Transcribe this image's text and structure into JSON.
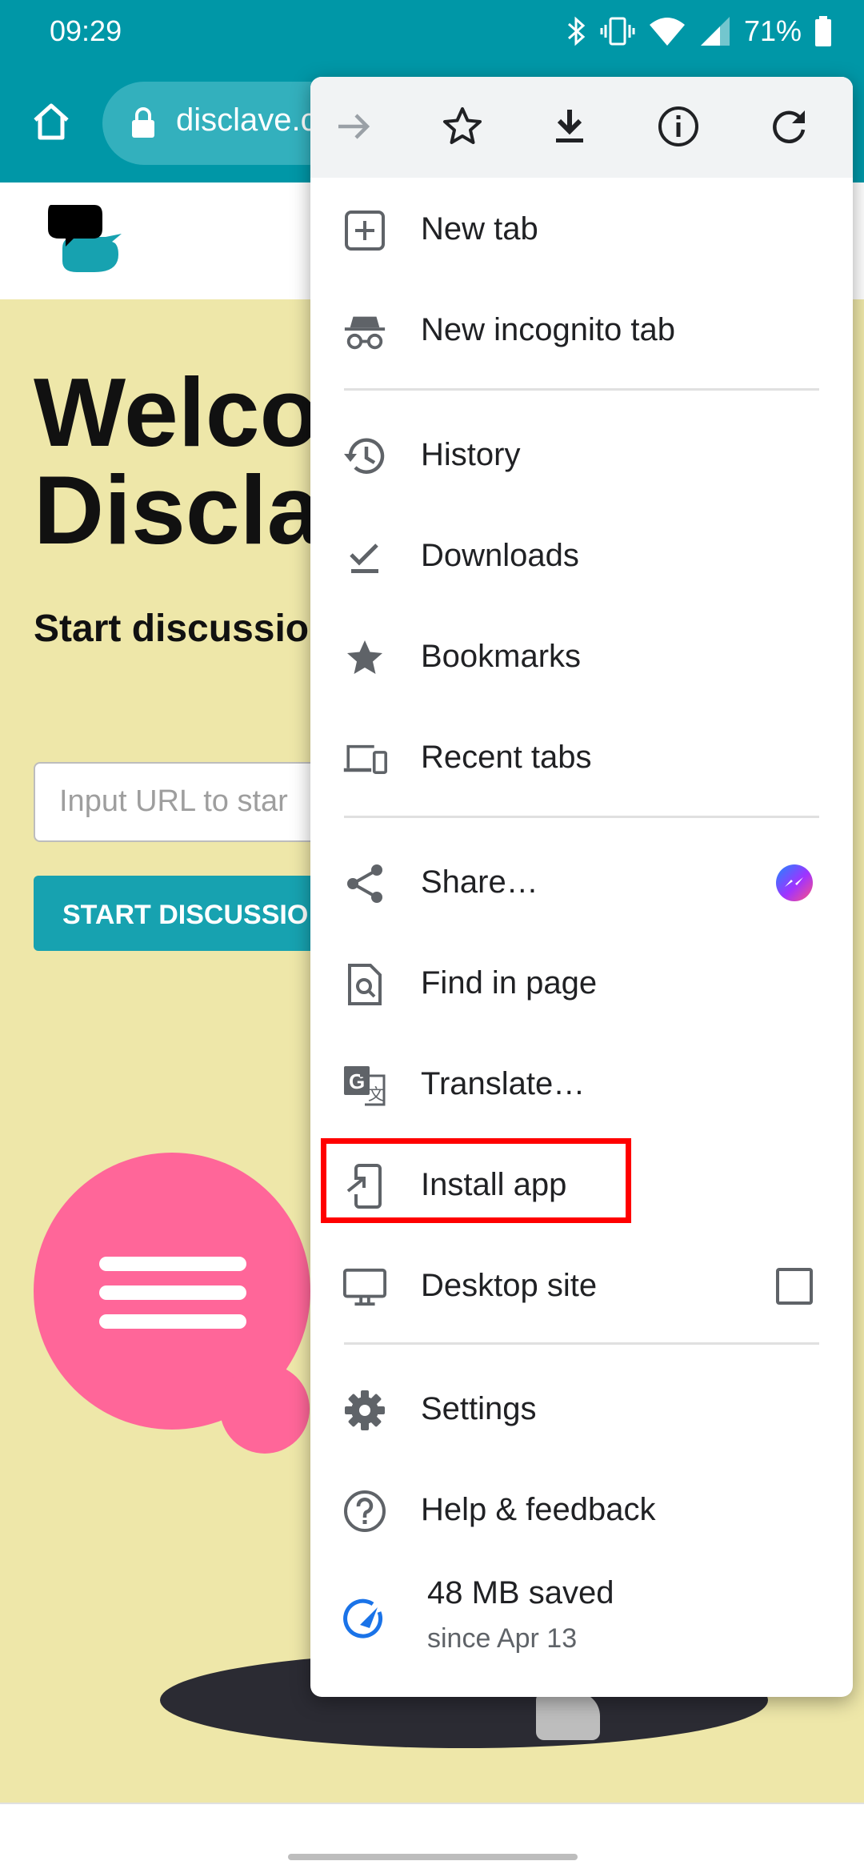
{
  "status_bar": {
    "time": "09:29",
    "battery": "71%",
    "icons": [
      "bluetooth-icon",
      "vibrate-icon",
      "wifi-icon",
      "signal-icon",
      "battery-icon"
    ]
  },
  "browser": {
    "url_text": "disclave.c",
    "home_icon": "home-icon",
    "lock_icon": "lock-icon"
  },
  "page": {
    "welcome_line1": "Welco",
    "welcome_line2": "Discla",
    "subtitle": "Start discussio",
    "url_placeholder": "Input URL to star",
    "start_button": "START DISCUSSIO"
  },
  "menu": {
    "toolbar_icons": [
      "forward-icon",
      "bookmark-star-icon",
      "download-icon",
      "info-icon",
      "refresh-icon"
    ],
    "items": [
      {
        "label": "New tab",
        "icon": "new-tab-icon"
      },
      {
        "label": "New incognito tab",
        "icon": "incognito-icon"
      },
      {
        "label": "History",
        "icon": "history-icon"
      },
      {
        "label": "Downloads",
        "icon": "downloads-icon"
      },
      {
        "label": "Bookmarks",
        "icon": "bookmarks-icon"
      },
      {
        "label": "Recent tabs",
        "icon": "recent-tabs-icon"
      },
      {
        "label": "Share…",
        "icon": "share-icon"
      },
      {
        "label": "Find in page",
        "icon": "find-in-page-icon"
      },
      {
        "label": "Translate…",
        "icon": "translate-icon"
      },
      {
        "label": "Install app",
        "icon": "install-app-icon"
      },
      {
        "label": "Desktop site",
        "icon": "desktop-icon"
      },
      {
        "label": "Settings",
        "icon": "settings-icon"
      },
      {
        "label": "Help & feedback",
        "icon": "help-icon"
      }
    ],
    "data_saver": {
      "main": "48 MB saved",
      "sub": "since Apr 13",
      "icon": "data-saver-icon"
    },
    "desktop_site_checked": false
  },
  "colors": {
    "accent": "#0097a7",
    "page_bg": "#eee7a9",
    "highlight": "#ff0000",
    "bubble": "#ff6699"
  }
}
